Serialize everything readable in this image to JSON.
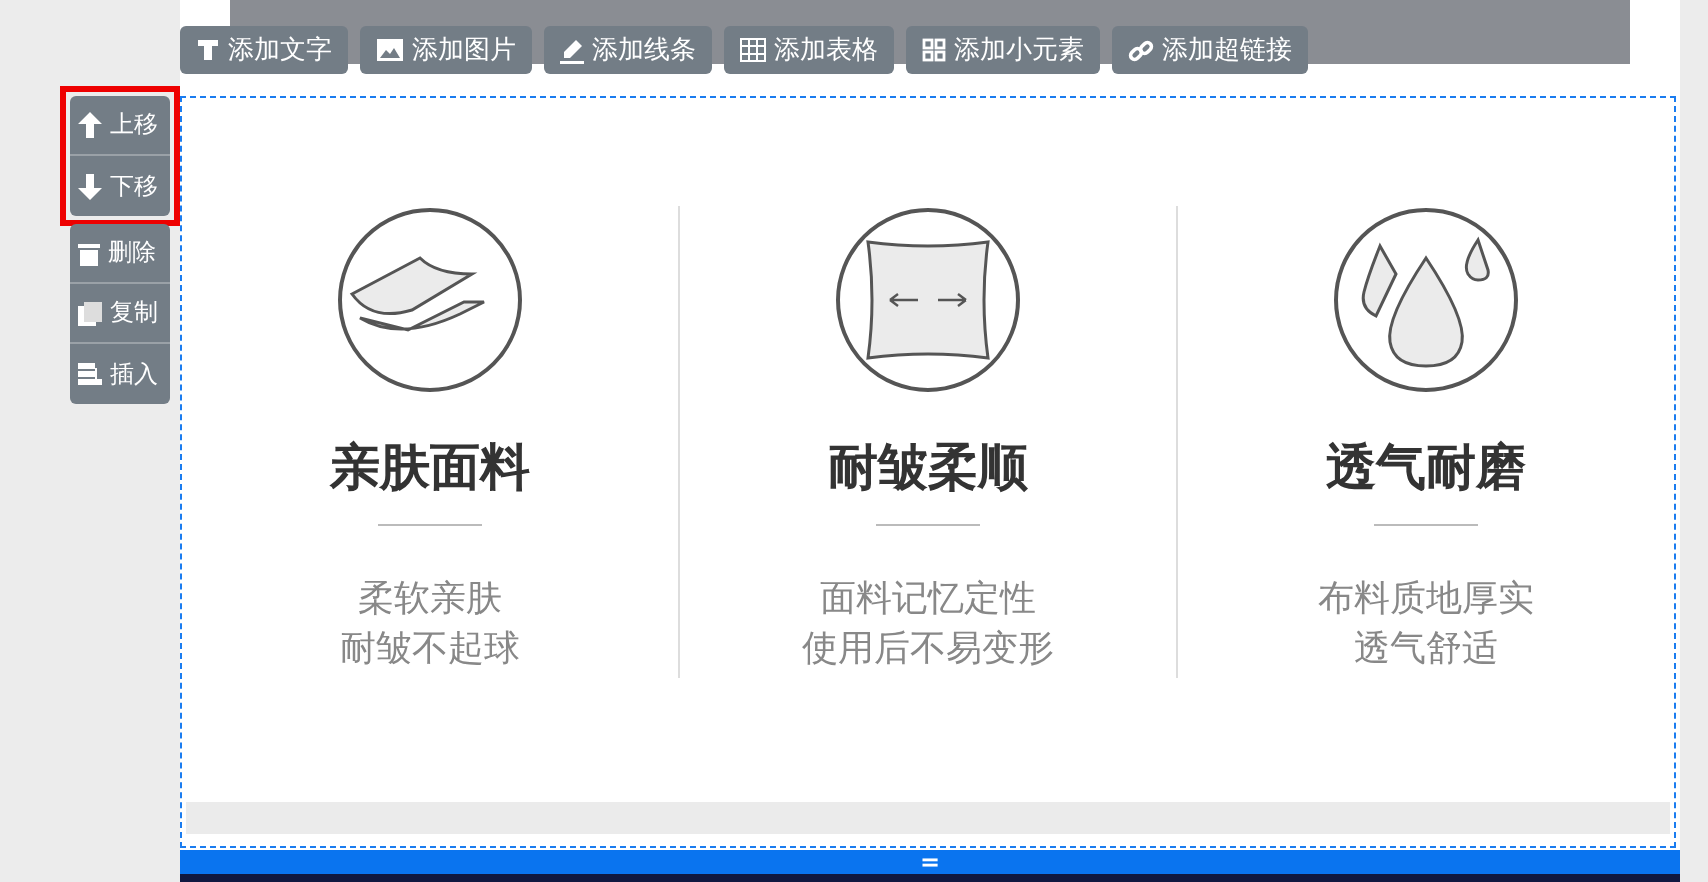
{
  "toolbar": [
    {
      "label": "添加文字"
    },
    {
      "label": "添加图片"
    },
    {
      "label": "添加线条"
    },
    {
      "label": "添加表格"
    },
    {
      "label": "添加小元素"
    },
    {
      "label": "添加超链接"
    }
  ],
  "side_groups": [
    {
      "highlighted": true,
      "tools": [
        {
          "label": "上移"
        },
        {
          "label": "下移"
        }
      ]
    },
    {
      "highlighted": false,
      "tools": [
        {
          "label": "删除"
        },
        {
          "label": "复制"
        },
        {
          "label": "插入"
        }
      ]
    }
  ],
  "features": [
    {
      "title": "亲肤面料",
      "lines": [
        "柔软亲肤",
        "耐皱不起球"
      ]
    },
    {
      "title": "耐皱柔顺",
      "lines": [
        "面料记忆定性",
        "使用后不易变形"
      ]
    },
    {
      "title": "透气耐磨",
      "lines": [
        "布料质地厚实",
        "透气舒适"
      ]
    }
  ],
  "bottom_bar": {
    "handle": "="
  }
}
